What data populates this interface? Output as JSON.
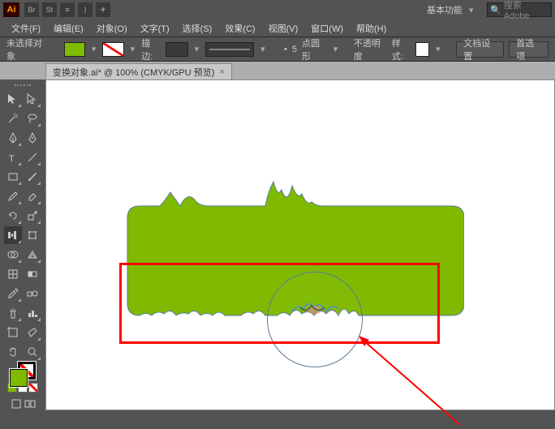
{
  "app": {
    "logo": "Ai"
  },
  "topbar": {
    "icons": [
      "Br",
      "St",
      "≡",
      "⟩",
      "✈"
    ],
    "workspace": "基本功能",
    "search_icon": "🔍",
    "search_placeholder": "搜索 Adobe"
  },
  "menu": {
    "file": "文件(F)",
    "edit": "编辑(E)",
    "object": "对象(O)",
    "type": "文字(T)",
    "select": "选择(S)",
    "effect": "效果(C)",
    "view": "视图(V)",
    "window": "窗口(W)",
    "help": "帮助(H)"
  },
  "ctrl": {
    "noselection": "未选择对象",
    "stroke_label": "描边:",
    "stroke_value": "",
    "style_size": "5",
    "style_label": "点圆形",
    "opacity_label": "不透明度",
    "style_text": "样式:",
    "doc_setup": "文档设置",
    "preferences": "首选项"
  },
  "tab": {
    "title": "变换对象.ai* @ 100% (CMYK/GPU 预览)",
    "close": "×"
  },
  "tools": {
    "list": [
      "selection",
      "direct-selection",
      "magic-wand",
      "lasso",
      "pen",
      "curvature",
      "type",
      "line",
      "rectangle",
      "paintbrush",
      "pencil",
      "blob-brush",
      "eraser",
      "rotate",
      "scale",
      "width",
      "free-transform",
      "shape-builder",
      "perspective",
      "mesh",
      "gradient",
      "eyedropper",
      "blend",
      "symbol-sprayer",
      "column-graph",
      "artboard",
      "slice",
      "hand",
      "zoom"
    ]
  },
  "colors": {
    "fill": "#7fba00",
    "stroke": "none"
  }
}
